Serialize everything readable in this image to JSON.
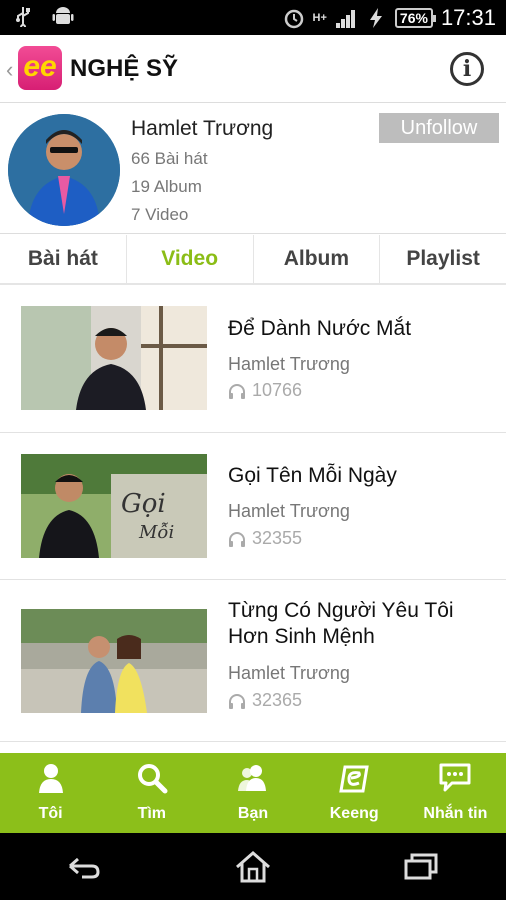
{
  "status_bar": {
    "time": "17:31",
    "battery": "76%",
    "network": "H+",
    "icons": [
      "usb-icon",
      "android-icon",
      "alarm-icon",
      "signal-icon",
      "charging-icon"
    ]
  },
  "app_bar": {
    "logo_text": "ee",
    "title": "NGHỆ SỸ",
    "back_icon": "chevron-left-icon",
    "info_icon": "info-icon"
  },
  "profile": {
    "name": "Hamlet Trương",
    "songs": "66 Bài hát",
    "albums": "19 Album",
    "videos": "7 Video",
    "unfollow_label": "Unfollow"
  },
  "tabs": [
    {
      "label": "Bài hát",
      "active": false
    },
    {
      "label": "Video",
      "active": true
    },
    {
      "label": "Album",
      "active": false
    },
    {
      "label": "Playlist",
      "active": false
    }
  ],
  "videos": [
    {
      "title": "Để Dành Nước Mắt",
      "artist": "Hamlet Trương",
      "plays": "10766"
    },
    {
      "title": "Gọi Tên Mỗi Ngày",
      "artist": "Hamlet Trương",
      "plays": "32355"
    },
    {
      "title": "Từng Có Người Yêu Tôi Hơn Sinh Mệnh",
      "artist": "Hamlet Trương",
      "plays": "32365"
    }
  ],
  "bottom_nav": [
    {
      "label": "Tôi",
      "icon": "user-icon"
    },
    {
      "label": "Tìm",
      "icon": "search-icon"
    },
    {
      "label": "Bạn",
      "icon": "friends-icon"
    },
    {
      "label": "Keeng",
      "icon": "keeng-icon"
    },
    {
      "label": "Nhắn tin",
      "icon": "chat-icon"
    }
  ],
  "colors": {
    "accent": "#8cbf1a",
    "active_tab": "#8bbd16",
    "unfollow_bg": "#bdbdbd",
    "logo": "#e2368a"
  }
}
